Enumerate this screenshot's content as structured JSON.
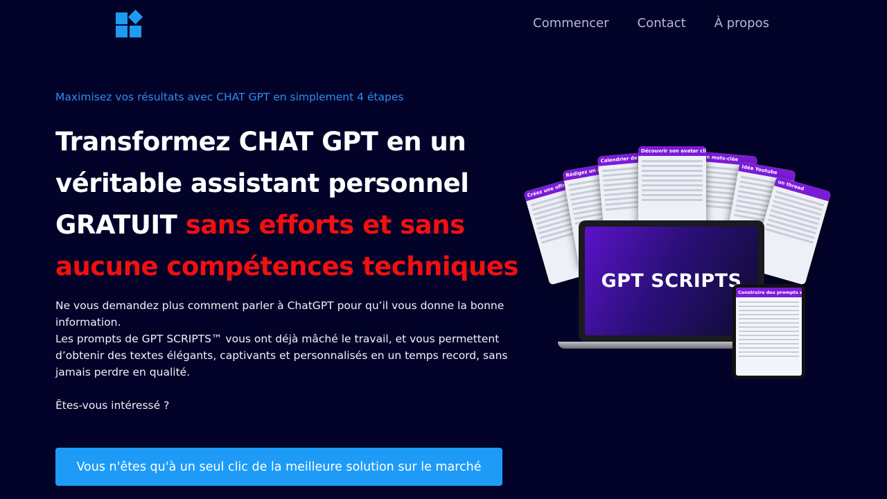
{
  "nav": {
    "items": [
      "Commencer",
      "Contact",
      "À propos"
    ]
  },
  "hero": {
    "eyebrow": "Maximisez vos résultats avec CHAT GPT en simplement 4 étapes",
    "title_white": "Transformez CHAT GPT en un véritable assistant personnel GRATUIT",
    "title_red": "sans efforts et sans aucune compétences techniques",
    "desc_1": "Ne vous demandez plus comment parler à ChatGPT pour qu’il vous donne la bonne information.",
    "desc_2": "Les prompts de GPT SCRIPTS™ vous ont déjà mâché le travail, et vous permettent d’obtenir des textes élégants, captivants et personnalisés en un temps record, sans jamais perdre en qualité.",
    "desc_3": "Êtes-vous intéressé ?",
    "cta": "Vous n'êtes qu'à un seul clic de la meilleure solution sur le marché"
  },
  "mockup": {
    "cards": [
      "Créez une offre",
      "Rédigez un a",
      "Calendrier de",
      "Découvrir son avatar client",
      "de mots-clée",
      "Idée Youtube",
      "un thread"
    ],
    "laptop_screen": "GPT SCRIPTS",
    "tablet_header": "Construire des prompts efficaces"
  },
  "colors": {
    "background": "#03032a",
    "accent": "#1e9bf7",
    "highlight": "#f20f0f",
    "card_header": "#7b1bd8"
  }
}
